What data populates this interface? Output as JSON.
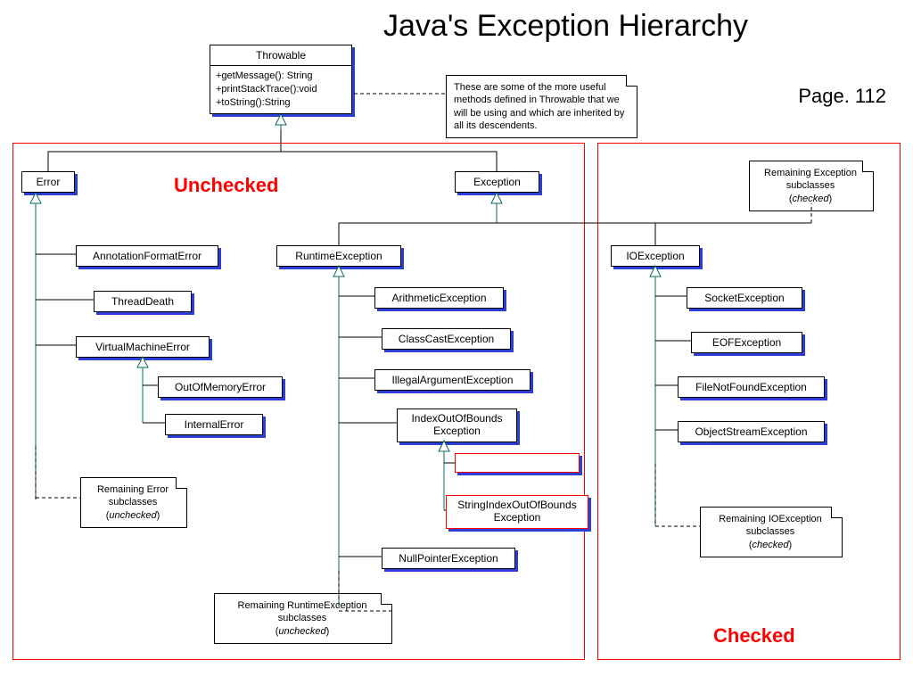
{
  "title": "Java's Exception Hierarchy",
  "page_label": "Page. 112",
  "labels": {
    "unchecked": "Unchecked",
    "checked": "Checked"
  },
  "throwable": {
    "name": "Throwable",
    "methods": "+getMessage(): String\n+printStackTrace():void\n+toString():String"
  },
  "notes": {
    "throwable_methods": "These are some of the more useful methods defined in Throwable that we will be using and which are inherited by all its descendents.",
    "remaining_error": "Remaining Error subclasses (unchecked)",
    "remaining_runtime": "Remaining RuntimeException subclasses (unchecked)",
    "remaining_exception": "Remaining Exception subclasses (checked)",
    "remaining_io": "Remaining IOException subclasses (checked)"
  },
  "classes": {
    "error": "Error",
    "annotation_format_error": "AnnotationFormatError",
    "thread_death": "ThreadDeath",
    "virtual_machine_error": "VirtualMachineError",
    "out_of_memory_error": "OutOfMemoryError",
    "internal_error": "InternalError",
    "exception": "Exception",
    "runtime_exception": "RuntimeException",
    "arithmetic_exception": "ArithmeticException",
    "class_cast_exception": "ClassCastException",
    "illegal_argument_exception": "IllegalArgumentException",
    "index_oob_exception": "IndexOutOfBounds Exception",
    "string_index_oob": "StringIndexOutOfBounds Exception",
    "null_pointer_exception": "NullPointerException",
    "io_exception": "IOException",
    "socket_exception": "SocketException",
    "eof_exception": "EOFException",
    "file_not_found_exception": "FileNotFoundException",
    "object_stream_exception": "ObjectStreamException"
  }
}
